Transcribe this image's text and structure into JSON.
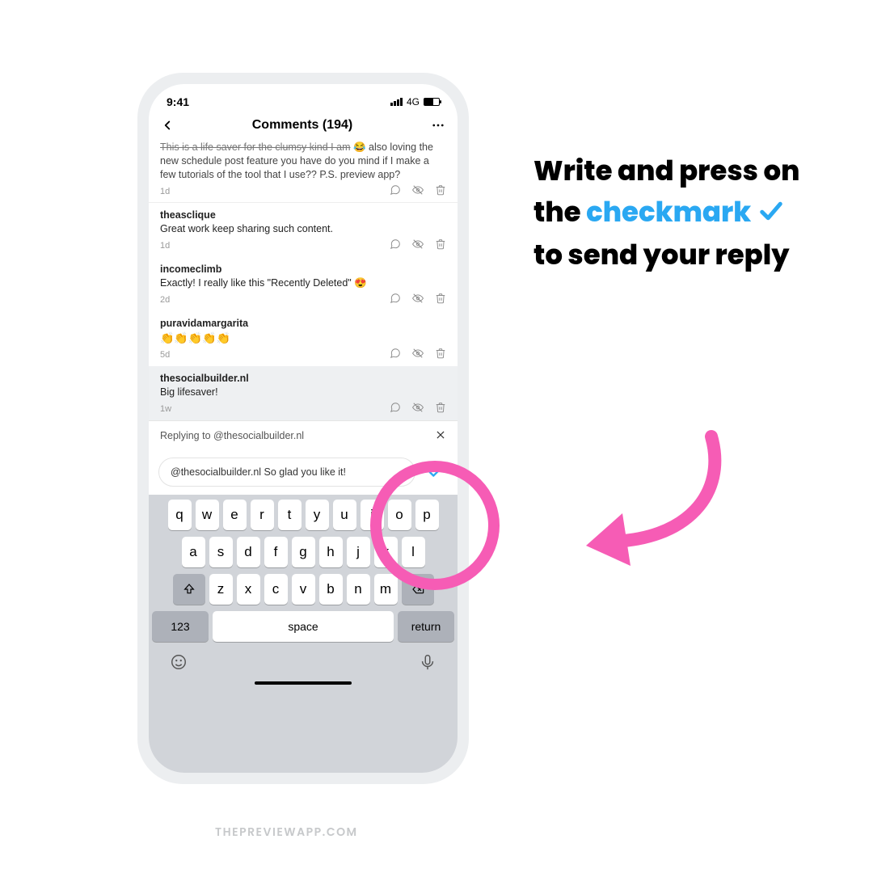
{
  "statusbar": {
    "time": "9:41",
    "network": "4G"
  },
  "header": {
    "title": "Comments (194)"
  },
  "first_comment_trunc": {
    "line1_struck": "This is a life saver for the clumsy kind I am",
    "line1_tail": " 😂 also loving",
    "rest": "the new schedule post feature you have do you mind if I make a few tutorials of the tool that I use?? P.S. preview app?",
    "time": "1d"
  },
  "comments": [
    {
      "user": "theasclique",
      "text": "Great work keep sharing such content.",
      "time": "1d"
    },
    {
      "user": "incomeclimb",
      "text": "Exactly! I really like this \"Recently Deleted\" 😍",
      "time": "2d"
    },
    {
      "user": "puravidamargarita",
      "text": "👏👏👏👏👏",
      "time": "5d"
    },
    {
      "user": "thesocialbuilder.nl",
      "text": "Big lifesaver!",
      "time": "1w",
      "selected": true
    }
  ],
  "reply": {
    "banner": "Replying to @thesocialbuilder.nl",
    "input_value": "@thesocialbuilder.nl So glad you like it!"
  },
  "keyboard": {
    "row1": [
      "q",
      "w",
      "e",
      "r",
      "t",
      "y",
      "u",
      "i",
      "o",
      "p"
    ],
    "row2": [
      "a",
      "s",
      "d",
      "f",
      "g",
      "h",
      "j",
      "k",
      "l"
    ],
    "row3": [
      "z",
      "x",
      "c",
      "v",
      "b",
      "n",
      "m"
    ],
    "num": "123",
    "space": "space",
    "ret": "return"
  },
  "instruction": {
    "pre": "Write and press on the ",
    "accent": "checkmark",
    "post": " to send your reply"
  },
  "watermark": "THEPREVIEWAPP.COM",
  "colors": {
    "accent": "#2aa8f2",
    "pink": "#f65cb5"
  }
}
